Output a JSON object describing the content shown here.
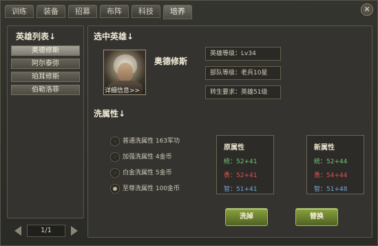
{
  "tabs": [
    "训练",
    "装备",
    "招募",
    "布阵",
    "科技",
    "培养"
  ],
  "left_panel": {
    "title": "英雄列表↓",
    "heroes": [
      "奥德修斯",
      "阿尔泰弥",
      "珀耳修斯",
      "伯勒洛菲"
    ],
    "page": "1/1"
  },
  "selected": {
    "title": "选中英雄↓",
    "hero_name": "奥德修斯",
    "detail_link": "详细信息>>",
    "hero_level": "英雄等级：Lv34",
    "unit_level": "部队等级：老兵10星",
    "rebirth_req": "转生要求：英雄51级"
  },
  "wash": {
    "title": "洗属性↓",
    "options": [
      {
        "label": "普通洗属性 163军功",
        "selected": false
      },
      {
        "label": "加强洗属性 4金币",
        "selected": false
      },
      {
        "label": "白金洗属性 5金币",
        "selected": false
      },
      {
        "label": "至尊洗属性 100金币",
        "selected": true
      }
    ]
  },
  "original_attrs": {
    "title": "原属性",
    "items": [
      "统：52+41",
      "勇：52+41",
      "智：51+41"
    ]
  },
  "new_attrs": {
    "title": "新属性",
    "items": [
      "统：52+44",
      "勇：54+44",
      "智：51+48"
    ]
  },
  "buttons": {
    "wash": "洗掉",
    "replace": "替换"
  },
  "colors": {
    "accent_green": "#76c87a",
    "accent_red": "#e05252",
    "accent_blue": "#76a8df"
  }
}
